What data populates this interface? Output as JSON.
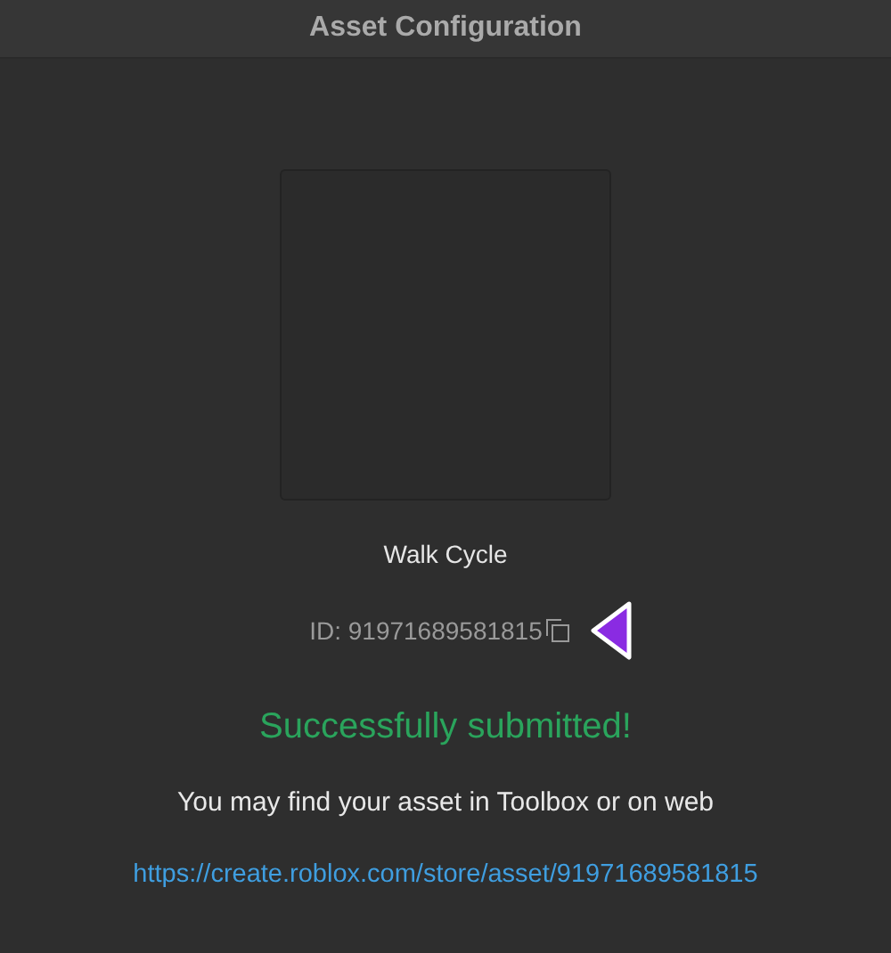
{
  "window": {
    "title": "Asset Configuration"
  },
  "asset": {
    "name": "Walk Cycle",
    "id_text": "ID: 91971689581815"
  },
  "status": "Successfully submitted!",
  "message": "You may find your asset in Toolbox or on web",
  "link": "https://create.roblox.com/store/asset/91971689581815"
}
